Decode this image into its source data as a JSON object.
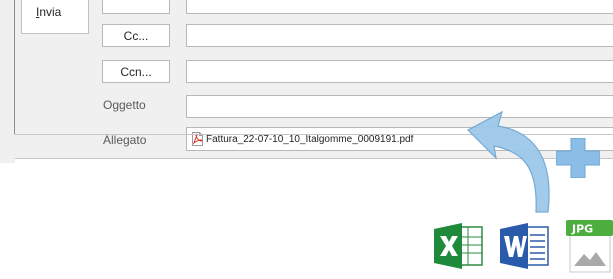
{
  "compose": {
    "send_label_first": "I",
    "send_label_rest": "nvia",
    "cc_label": "Cc...",
    "bcc_label": "Ccn...",
    "subject_label": "Oggetto",
    "attachment_label": "Allegato",
    "attachment_filename": "Fattura_22-07-10_10_Italgomme_0009191.pdf"
  },
  "icons": {
    "pdf": "pdf-file-icon",
    "arrow": "curved-upload-arrow-icon",
    "plus": "plus-icon",
    "excel": "excel-file-icon",
    "word": "word-file-icon",
    "jpg": "jpg-image-icon"
  },
  "badges": {
    "jpg": "JPG"
  },
  "colors": {
    "arrow_blue": "#7ab4e0",
    "excel_green": "#1f8a3b",
    "word_blue": "#2a5bab",
    "jpg_green": "#4cae3c",
    "pdf_red": "#d9261c"
  }
}
